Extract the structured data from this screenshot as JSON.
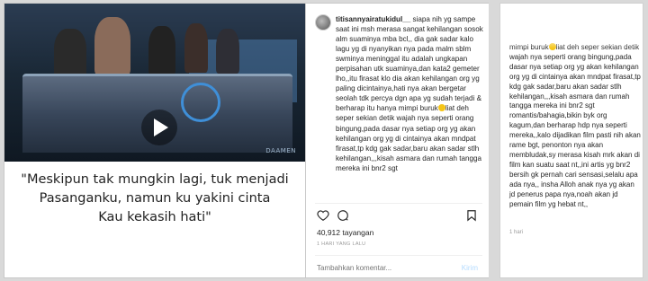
{
  "video": {
    "watermark": "DAAMEN",
    "quote_lines": [
      "\"Meskipun tak mungkin lagi, tuk menjadi",
      "Pasanganku, namun ku yakini cinta",
      "Kau kekasih hati\""
    ]
  },
  "post": {
    "username": "titisannyairatukidul__",
    "caption_part1": "siapa nih yg sampe saat ini msh merasa sangat kehilangan sosok alm suaminya mba bcl,, dia gak sadar kalo lagu yg di nyanyikan nya pada malm sblm swminya meninggal itu adalah ungkapan perpisahan utk suaminya,dan kata2 gemeter lho,,itu firasat klo dia akan kehilangan org yg paling dicintainya,hati nya akan bergetar seolah tdk percya dgn apa yg sudah terjadi & berharap itu hanya mimpi buruk",
    "caption_part2": "liat deh seper sekian detik wajah nya seperti orang bingung,pada dasar nya setiap org yg akan kehilangan org yg di cintainya akan mndpat firasat,tp kdg gak sadar,baru akan sadar stlh kehilangan,,,kisah asmara dan rumah tangga mereka ini bnr2 sgt",
    "views": "40,912 tayangan",
    "time": "1 HARI YANG LALU",
    "comment_placeholder": "Tambahkan komentar...",
    "send_label": "Kirim",
    "more_label": "•••"
  },
  "side": {
    "caption_part1": "mimpi buruk",
    "caption_part2": "liat deh seper sekian detik wajah nya seperti orang bingung,pada dasar nya setiap org yg akan kehilangan org yg di cintainya akan mndpat firasat,tp kdg gak sadar,baru akan sadar stlh kehilangan,,,kisah asmara dan rumah tangga mereka ini bnr2 sgt romantis/bahagia,bikin byk org kagum,dan berharap hdp nya seperti mereka,,kalo dijadikan film pasti nih akan rame bgt, penonton nya akan membludak,sy merasa kisah mrk akan di film kan suatu saat nt,,ini artis yg bnr2 bersih gk pernah cari sensasi,selalu apa ada nya,, insha Alloh anak nya yg akan jd penerus papa nya,noah akan jd pemain film yg hebat nt,,",
    "time": "1 hari"
  }
}
